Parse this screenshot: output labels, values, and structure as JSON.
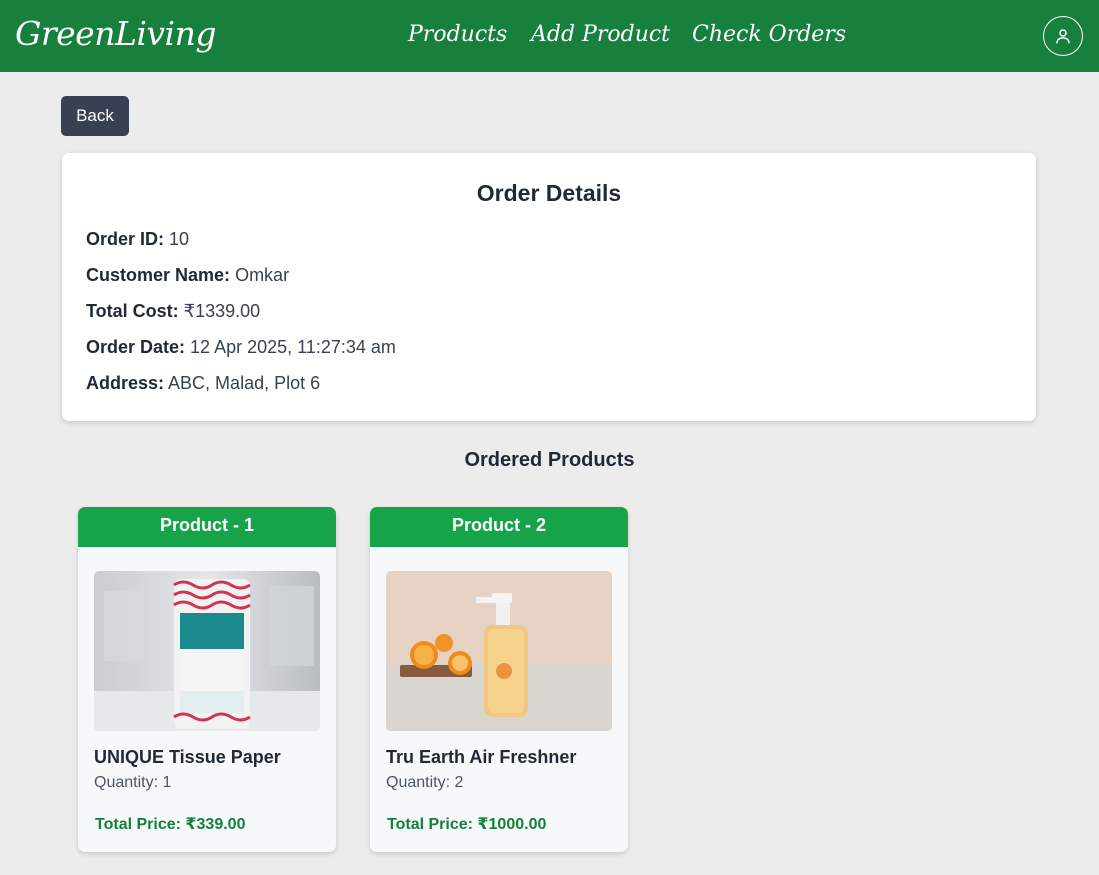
{
  "navbar": {
    "brand": "GreenLiving",
    "links": [
      "Products",
      "Add Product",
      "Check Orders"
    ],
    "profile_icon": "user-icon",
    "background": "#16803c"
  },
  "back_label": "Back",
  "order": {
    "title": "Order Details",
    "id_label": "Order ID:",
    "id_value": "10",
    "customer_label": "Customer Name:",
    "customer_value": "Omkar",
    "cost_label": "Total Cost:",
    "cost_value": "₹1339.00",
    "date_label": "Order Date:",
    "date_value": "12 Apr 2025, 11:27:34 am",
    "address_label": "Address:",
    "address_value": "ABC, Malad, Plot 6"
  },
  "ordered_products": {
    "title": "Ordered Products",
    "items": [
      {
        "header": "Product - 1",
        "name": "UNIQUE Tissue Paper",
        "quantity": "Quantity: 1",
        "price": "Total Price: ₹339.00",
        "image": "tissue-roll-image"
      },
      {
        "header": "Product - 2",
        "name": "Tru Earth Air Freshner",
        "quantity": "Quantity: 2",
        "price": "Total Price: ₹1000.00",
        "image": "air-freshener-spray-image"
      }
    ]
  },
  "colors": {
    "accent": "#16a34a",
    "price": "#15803d",
    "back_button": "#374151"
  }
}
